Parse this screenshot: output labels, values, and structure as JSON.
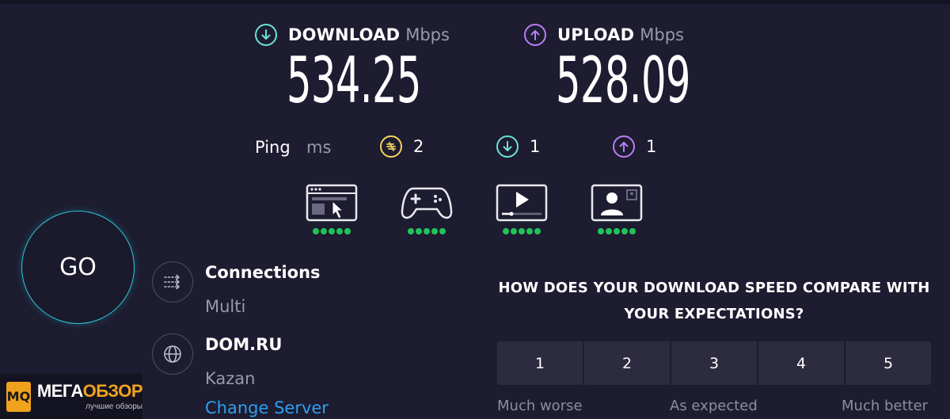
{
  "speed": {
    "download": {
      "title": "DOWNLOAD",
      "unit": "Mbps",
      "value": "534.25",
      "icon": "arrow-down-circle-icon",
      "color": "#6ae3d8"
    },
    "upload": {
      "title": "UPLOAD",
      "unit": "Mbps",
      "value": "528.09",
      "icon": "arrow-up-circle-icon",
      "color": "#b97ef5"
    }
  },
  "ping": {
    "label": "Ping",
    "unit": "ms",
    "idle": {
      "value": "2",
      "icon": "ping-idle-icon",
      "color": "#f4d35e"
    },
    "download": {
      "value": "1",
      "icon": "arrow-down-circle-icon",
      "color": "#6ae3d8"
    },
    "upload": {
      "value": "1",
      "icon": "arrow-up-circle-icon",
      "color": "#b97ef5"
    }
  },
  "usage": [
    {
      "icon": "web-browsing-icon",
      "rating": 5
    },
    {
      "icon": "gaming-icon",
      "rating": 5
    },
    {
      "icon": "video-streaming-icon",
      "rating": 5
    },
    {
      "icon": "video-chat-icon",
      "rating": 5
    }
  ],
  "go_button": {
    "label": "GO"
  },
  "connections": {
    "title": "Connections",
    "value": "Multi",
    "icon": "connections-icon"
  },
  "server": {
    "title": "DOM.RU",
    "location": "Kazan",
    "change_label": "Change Server",
    "icon": "globe-icon"
  },
  "survey": {
    "question": "HOW DOES YOUR DOWNLOAD SPEED COMPARE WITH YOUR EXPECTATIONS?",
    "options": [
      "1",
      "2",
      "3",
      "4",
      "5"
    ],
    "low_label": "Much worse",
    "mid_label": "As expected",
    "high_label": "Much better"
  },
  "watermark": {
    "logo": "MQ",
    "title_a": "МЕГА",
    "title_b": "ОБЗОР",
    "subtitle": "лучшие обзоры"
  },
  "colors": {
    "background": "#1d1c30",
    "accent_link": "#2e9ff0",
    "go_ring": "#2cc8d8",
    "good": "#21c45b"
  }
}
